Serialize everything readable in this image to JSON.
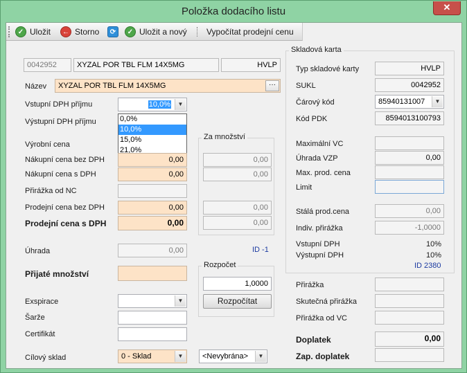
{
  "window": {
    "title": "Položka dodacího listu",
    "close_glyph": "✕"
  },
  "toolbar": {
    "save": "Uložit",
    "cancel": "Storno",
    "save_new": "Uložit a nový",
    "calc_price": "Vypočítat prodejní cenu"
  },
  "item": {
    "code": "0042952",
    "name_short": "XYZAL POR TBL FLM 14X5MG",
    "supplier_tag": "HVLP"
  },
  "form": {
    "name_label": "Název",
    "name_value": "XYZAL POR TBL FLM 14X5MG",
    "ellipsis": "···",
    "vat_in_label": "Vstupní DPH příjmu",
    "vat_in_value": "10,0%",
    "vat_options": [
      "0,0%",
      "10,0%",
      "15,0%",
      "21,0%"
    ],
    "vat_out_label": "Výstupní DPH příjmu",
    "producer_price_label": "Výrobní cena",
    "purchase_ex_label": "Nákupní cena bez DPH",
    "purchase_ex_value": "0,00",
    "purchase_in_label": "Nákupní cena s DPH",
    "purchase_in_value": "0,00",
    "markup_nc_label": "Přirážka od NC",
    "sale_ex_label": "Prodejní cena bez DPH",
    "sale_ex_value": "0,00",
    "sale_in_label": "Prodejní cena s DPH",
    "sale_in_value": "0,00",
    "payment_label": "Úhrada",
    "payment_value": "0,00",
    "id_text": "ID -1",
    "received_qty_label": "Přijaté množství",
    "expiry_label": "Exspirace",
    "batch_label": "Šarže",
    "certificate_label": "Certifikát",
    "target_store_label": "Cílový sklad",
    "target_store_value": "0 - Sklad",
    "collection_value": "<Nevybrána>"
  },
  "per_qty": {
    "title": "Za množství",
    "values": [
      "0,00",
      "0,00",
      "0,00",
      "0,00"
    ]
  },
  "breakdown": {
    "title": "Rozpočet",
    "value": "1,0000",
    "button": "Rozpočítat"
  },
  "stock_card": {
    "title": "Skladová karta",
    "type_label": "Typ skladové karty",
    "type_value": "HVLP",
    "sukl_label": "SUKL",
    "sukl_value": "0042952",
    "barcode_label": "Čárový kód",
    "barcode_value": "85940131007",
    "pdk_label": "Kód PDK",
    "pdk_value": "8594013100793",
    "max_vc_label": "Maximální VC",
    "vzp_label": "Úhrada VZP",
    "vzp_value": "0,00",
    "max_sale_label": "Max. prod. cena",
    "limit_label": "Limit",
    "fixed_price_label": "Stálá prod.cena",
    "fixed_price_value": "0,00",
    "indiv_markup_label": "Indiv. přirážka",
    "indiv_markup_value": "-1,0000",
    "vat_in_label": "Vstupní DPH",
    "vat_in_value": "10%",
    "vat_out_label": "Výstupní DPH",
    "vat_out_value": "10%",
    "id_text": "ID 2380"
  },
  "markups": {
    "markup_label": "Přirážka",
    "real_markup_label": "Skutečná přirážka",
    "markup_vc_label": "Přirážka od VC",
    "surcharge_label": "Doplatek",
    "surcharge_value": "0,00",
    "fixed_surcharge_label": "Zap. doplatek"
  },
  "colors": {
    "window_frame": "#8fd3a4",
    "editable_field": "#fde3c7",
    "selection": "#3399ff"
  }
}
